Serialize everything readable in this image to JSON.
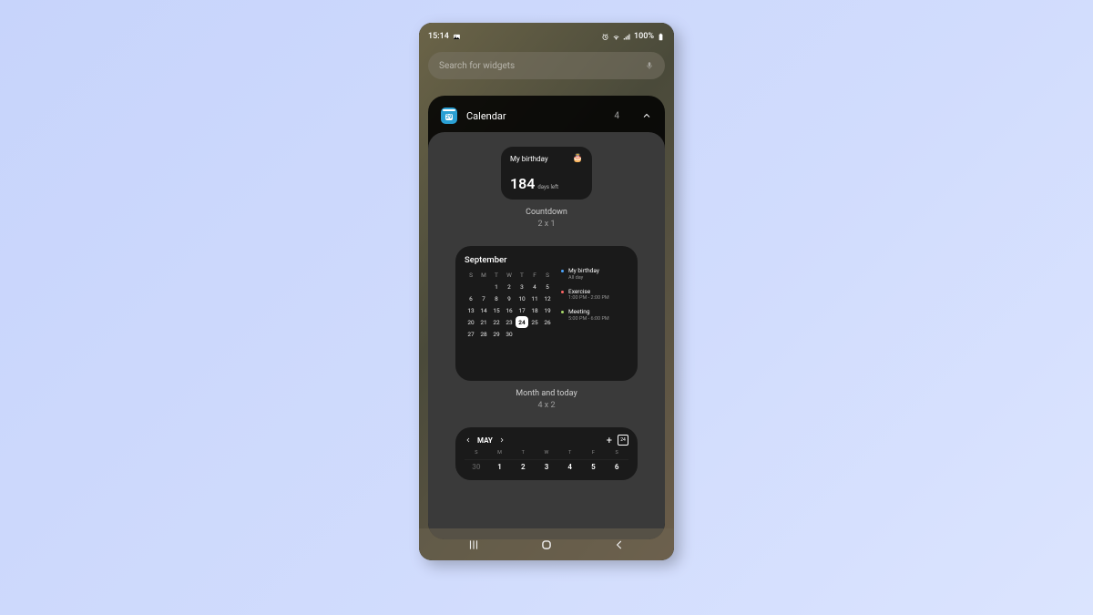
{
  "status": {
    "time": "15:14",
    "battery_pct": "100%"
  },
  "search": {
    "placeholder": "Search for widgets"
  },
  "panel": {
    "app_name": "Calendar",
    "icon_day": "29",
    "count": "4"
  },
  "countdown": {
    "title": "My birthday",
    "number": "184",
    "unit": "days left",
    "caption": "Countdown",
    "size": "2 x 1"
  },
  "month": {
    "title": "September",
    "dow": [
      "S",
      "M",
      "T",
      "W",
      "T",
      "F",
      "S"
    ],
    "weeks": [
      [
        "",
        "",
        "1",
        "2",
        "3",
        "4",
        "5"
      ],
      [
        "6",
        "7",
        "8",
        "9",
        "10",
        "11",
        "12"
      ],
      [
        "13",
        "14",
        "15",
        "16",
        "17",
        "18",
        "19"
      ],
      [
        "20",
        "21",
        "22",
        "23",
        "24",
        "25",
        "26"
      ],
      [
        "27",
        "28",
        "29",
        "30",
        "",
        "",
        ""
      ]
    ],
    "selected": "24",
    "events": [
      {
        "title": "My birthday",
        "time": "All day",
        "color": "b"
      },
      {
        "title": "Exercise",
        "time": "1:00 PM - 2:00 PM",
        "color": "r"
      },
      {
        "title": "Meeting",
        "time": "5:00 PM - 6:00 PM",
        "color": "g"
      }
    ],
    "caption": "Month and today",
    "size": "4 x 2"
  },
  "week": {
    "month": "MAY",
    "today_num": "24",
    "dow": [
      "S",
      "M",
      "T",
      "W",
      "T",
      "F",
      "S"
    ],
    "days": [
      "30",
      "1",
      "2",
      "3",
      "4",
      "5",
      "6"
    ],
    "prev_month_idx": 0
  }
}
